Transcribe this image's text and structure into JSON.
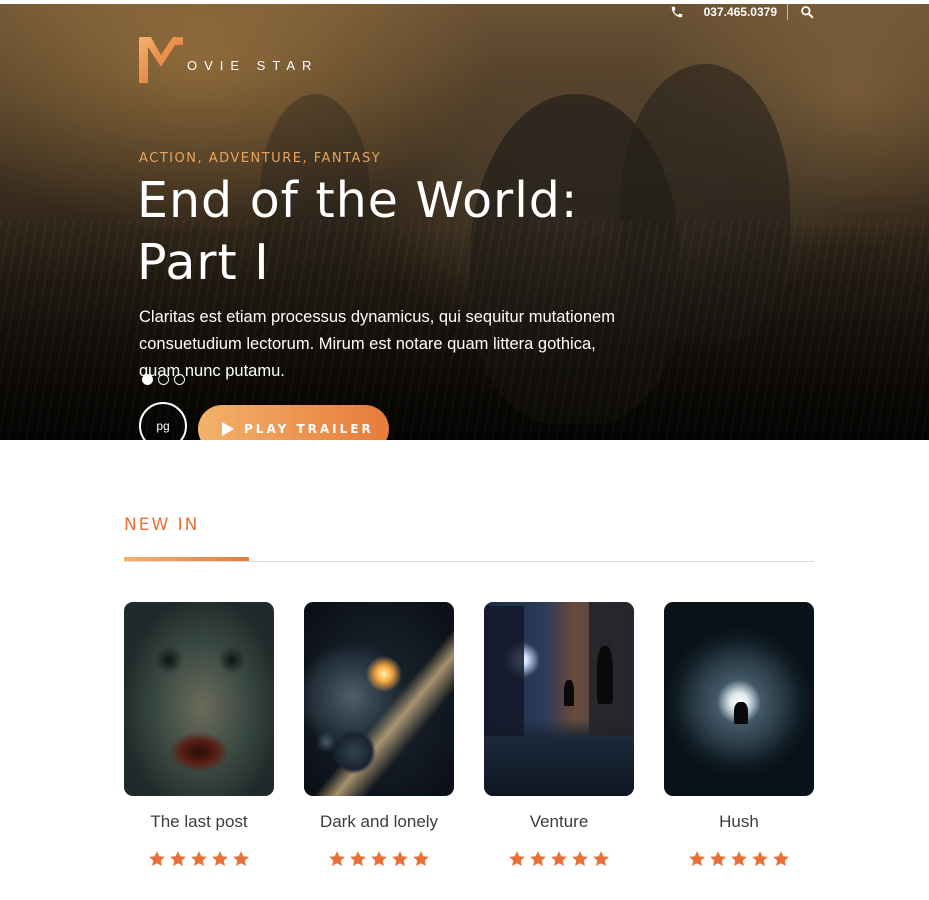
{
  "header": {
    "phone": "037.465.0379",
    "logo_letter": "M",
    "logo_text": "OVIE STAR"
  },
  "hero": {
    "genres": "ACTION, ADVENTURE, FANTASY",
    "title": "End of the World: Part I",
    "description": "Claritas est etiam processus dynamicus, qui sequitur mutationem consuetudium lectorum. Mirum est notare quam littera gothica, quam nunc putamu.",
    "slides": 3,
    "active_slide": 1,
    "rating": "pg",
    "trailer_label": "PLAY TRAILER"
  },
  "section": {
    "title": "NEW IN"
  },
  "movies": [
    {
      "title": "The last post",
      "stars": 5
    },
    {
      "title": "Dark and lonely",
      "stars": 5
    },
    {
      "title": "Venture",
      "stars": 5
    },
    {
      "title": "Hush",
      "stars": 5
    }
  ],
  "colors": {
    "accent": "#e8713a",
    "accent_light": "#f3b26a",
    "genre": "#e9a45f",
    "star": "#e8713a"
  },
  "icons": {
    "phone": "phone-icon",
    "search": "search-icon",
    "play": "play-icon",
    "star": "star-icon"
  }
}
